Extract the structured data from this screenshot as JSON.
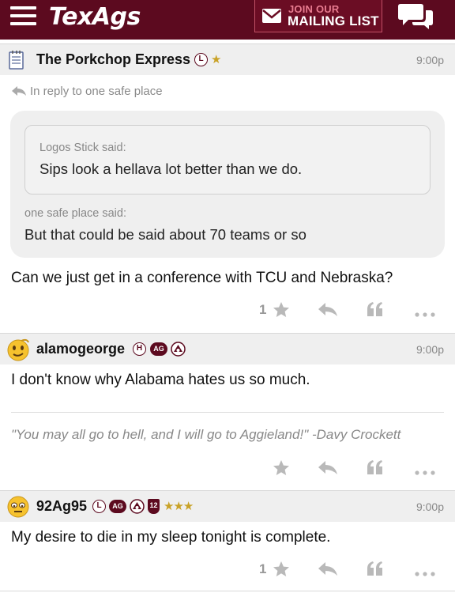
{
  "header": {
    "brand": "TexAgs",
    "mailing_line1": "JOIN OUR",
    "mailing_line2": "MAILING LIST"
  },
  "posts": [
    {
      "username": "The Porkchop Express",
      "badges": [
        "L"
      ],
      "stars": "★",
      "time": "9:00p",
      "reply_to": "In reply to one safe place",
      "quote_nested_attr": "Logos Stick said:",
      "quote_nested_text": "Sips look a hellava lot better than we do.",
      "quote_attr": "one safe place said:",
      "quote_text": "But that could be said about 70 teams or so",
      "body": "Can we just get in a conference with TCU and Nebraska?",
      "star_count": "1"
    },
    {
      "username": "alamogeorge",
      "badges": [
        "H",
        "AG"
      ],
      "time": "9:00p",
      "body": "I don't know why Alabama hates us so much.",
      "signature": "\"You may all go to hell, and I will go to Aggieland!\" -Davy Crockett"
    },
    {
      "username": "92Ag95",
      "badges": [
        "L",
        "AG",
        "12"
      ],
      "stars": "★★★",
      "time": "9:00p",
      "body": "My desire to die in my sleep tonight is complete.",
      "star_count": "1"
    }
  ],
  "colors": {
    "brand": "#5c0a1f",
    "header_bar": "#efefef",
    "star_gold": "#c9a227",
    "icon_gray": "#b9b9b9"
  },
  "icons": [
    "menu-icon",
    "envelope-icon",
    "chat-icon",
    "notepad-avatar",
    "reply-arrow-icon",
    "star-icon",
    "reply-icon",
    "quote-icon",
    "more-icon"
  ]
}
